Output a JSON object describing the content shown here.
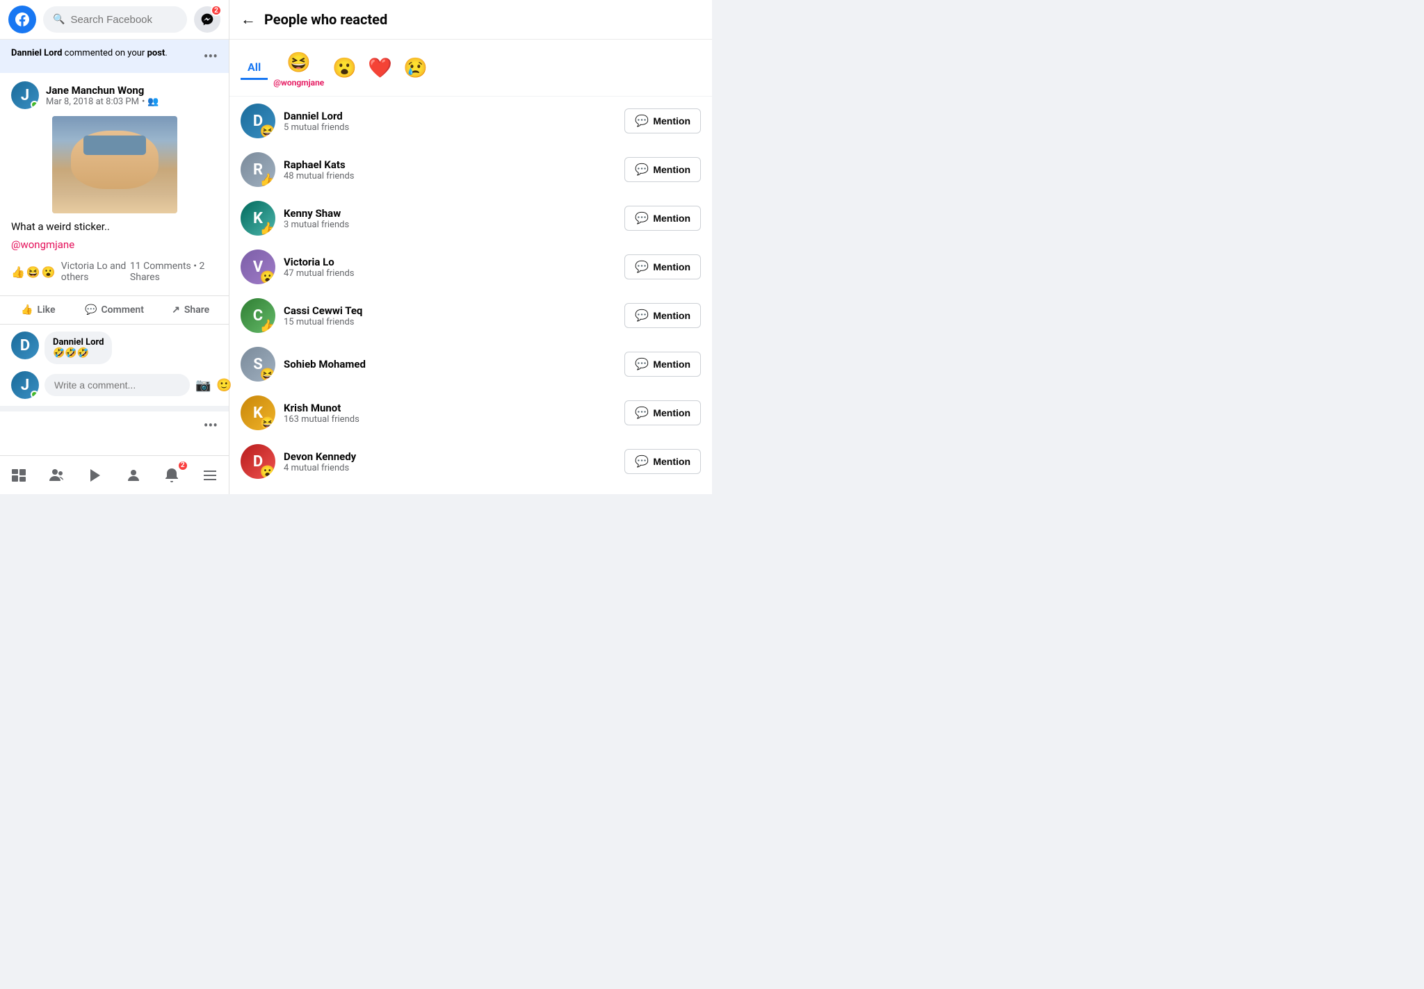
{
  "header": {
    "search_placeholder": "Search Facebook",
    "messenger_badge": "2"
  },
  "notification": {
    "text_pre": "Danniel Lord",
    "text_mid": " commented on your ",
    "text_bold": "post",
    "text_end": ".",
    "more_icon": "•••"
  },
  "post": {
    "author": "Jane Manchun Wong",
    "date": "Mar 8, 2018 at 8:03 PM",
    "caption": "What a weird sticker..",
    "mention": "@wongmjane",
    "reactions_label": "Victoria Lo and others",
    "comments_count": "11 Comments",
    "shares_count": "2 Shares",
    "actions": {
      "like": "Like",
      "comment": "Comment",
      "share": "Share"
    },
    "comment": {
      "author": "Danniel Lord",
      "text": "🤣🤣🤣"
    },
    "comment_input_placeholder": "Write a comment..."
  },
  "bottom_nav": {
    "notification_badge": "2"
  },
  "right_panel": {
    "title": "People who reacted",
    "filters": {
      "all": "All",
      "mention_tag": "@wongmjane"
    },
    "people": [
      {
        "name": "Danniel Lord",
        "mutual": "5 mutual friends",
        "reaction": "😆",
        "avatar_class": "av-blue"
      },
      {
        "name": "Raphael Kats",
        "mutual": "48 mutual friends",
        "reaction": "👍",
        "avatar_class": "av-gray"
      },
      {
        "name": "Kenny Shaw",
        "mutual": "3 mutual friends",
        "reaction": "👍",
        "avatar_class": "av-teal"
      },
      {
        "name": "Victoria Lo",
        "mutual": "47 mutual friends",
        "reaction": "😮",
        "avatar_class": "av-purple"
      },
      {
        "name": "Cassi Cewwi Teq",
        "mutual": "15 mutual friends",
        "reaction": "👍",
        "avatar_class": "av-green"
      },
      {
        "name": "Sohieb Mohamed",
        "mutual": "",
        "reaction": "😆",
        "avatar_class": "av-gray"
      },
      {
        "name": "Krish Munot",
        "mutual": "163 mutual friends",
        "reaction": "😆",
        "avatar_class": "av-golden"
      },
      {
        "name": "Devon Kennedy",
        "mutual": "4 mutual friends",
        "reaction": "😮",
        "avatar_class": "av-red"
      }
    ],
    "mention_button_label": "Mention"
  }
}
